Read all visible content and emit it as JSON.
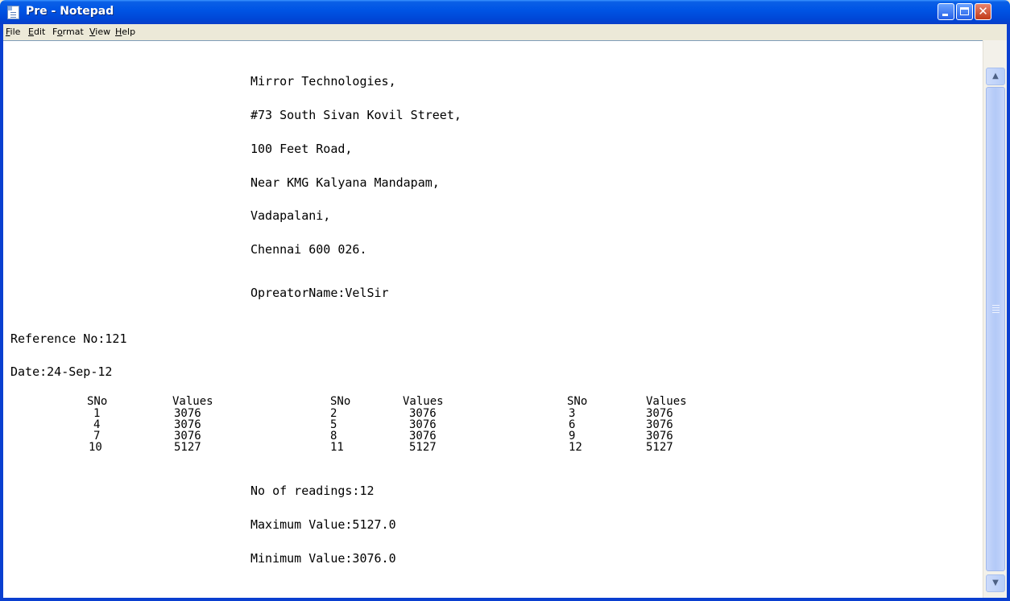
{
  "window": {
    "title": "Pre - Notepad",
    "close_glyph": "✕"
  },
  "menu": {
    "file": {
      "first": "F",
      "rest": "ile"
    },
    "edit": {
      "first": "E",
      "rest": "dit"
    },
    "format": {
      "pre": "F",
      "u": "o",
      "post": "rmat"
    },
    "view": {
      "first": "V",
      "rest": "iew"
    },
    "help": {
      "first": "H",
      "rest": "elp"
    }
  },
  "document": {
    "address": [
      "Mirror Technologies,",
      "#73 South Sivan Kovil Street,",
      "100 Feet Road,",
      "Near KMG Kalyana Mandapam,",
      "Vadapalani,",
      "Chennai 600 026."
    ],
    "operator": "OpreatorName:VelSir",
    "reference": "Reference No:121",
    "date": "Date:24-Sep-12",
    "table": {
      "header_sno": "SNo",
      "header_values": "Values",
      "rows": [
        [
          {
            "sno": "1",
            "val": "3076"
          },
          {
            "sno": "2",
            "val": "3076"
          },
          {
            "sno": "3",
            "val": "3076"
          }
        ],
        [
          {
            "sno": "4",
            "val": "3076"
          },
          {
            "sno": "5",
            "val": "3076"
          },
          {
            "sno": "6",
            "val": "3076"
          }
        ],
        [
          {
            "sno": "7",
            "val": "3076"
          },
          {
            "sno": "8",
            "val": "3076"
          },
          {
            "sno": "9",
            "val": "3076"
          }
        ],
        [
          {
            "sno": "10",
            "val": "5127"
          },
          {
            "sno": "11",
            "val": "5127"
          },
          {
            "sno": "12",
            "val": "5127"
          }
        ]
      ]
    },
    "readings": "No of readings:12",
    "maximum": "Maximum Value:5127.0",
    "minimum": "Minimum Value:3076.0"
  },
  "scrollbar": {
    "up_glyph": "▲",
    "down_glyph": "▼"
  },
  "colors": {
    "titlebar": "#0055e5",
    "close_button": "#c13a18",
    "menubar": "#ece9d8",
    "editor_background": "#ffffff"
  }
}
